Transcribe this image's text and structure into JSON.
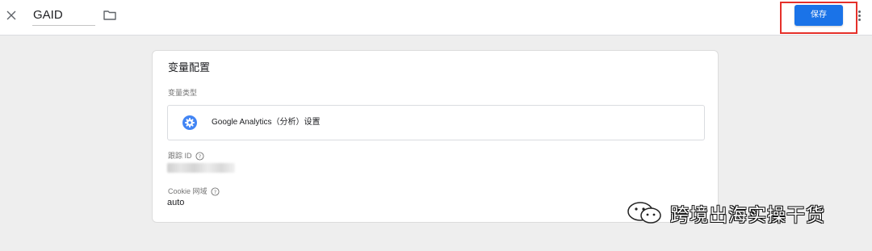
{
  "header": {
    "close_icon": "close-icon",
    "variable_name": "GAID",
    "folder_icon": "folder-icon",
    "save_label": "保存",
    "more_icon": "more-vert-icon",
    "save_highlight_color": "#e5302a",
    "accent_color": "#1a73e8"
  },
  "card": {
    "title": "变量配置",
    "variable_type_label": "变量类型",
    "variable_type_icon": "gear-icon",
    "variable_type_value": "Google Analytics（分析）设置",
    "tracking_id_label": "跟踪 ID",
    "tracking_id_help_icon": "help-icon",
    "cookie_domain_label": "Cookie 网域",
    "cookie_domain_help_icon": "help-icon",
    "cookie_domain_value": "auto"
  },
  "watermark": {
    "icon": "wechat-icon",
    "text": "跨境出海实操干货"
  }
}
